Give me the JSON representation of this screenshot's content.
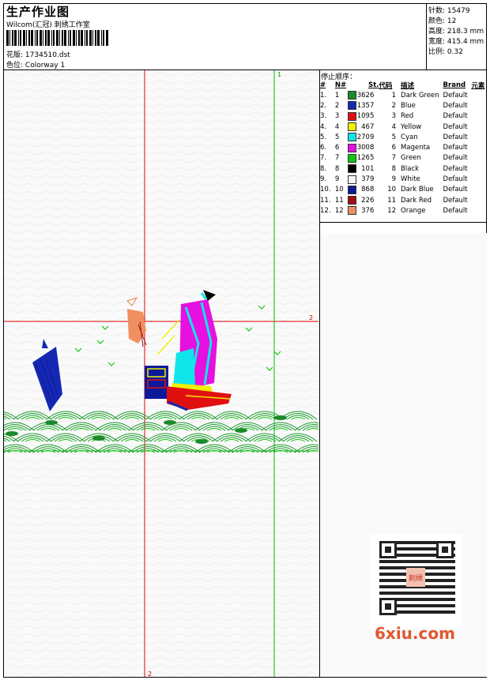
{
  "header": {
    "title": "生产作业图",
    "subtitle": "Wilcom(汇冠) 刺绣工作室",
    "design_label": "花版:",
    "design_value": "1734510.dst",
    "color_label": "色位:",
    "color_value": "Colorway 1"
  },
  "stats": [
    {
      "label": "针数:",
      "value": "15479"
    },
    {
      "label": "颜色:",
      "value": "12"
    },
    {
      "label": "高度:",
      "value": "218.3 mm"
    },
    {
      "label": "宽度:",
      "value": "415.4 mm"
    },
    {
      "label": "比例:",
      "value": "0.32"
    }
  ],
  "legend": {
    "title": "停止顺序：",
    "headers": [
      "#",
      "N#",
      "St.",
      "代码",
      "描述",
      "Brand",
      "元素"
    ],
    "rows": [
      {
        "n": "1.",
        "num": "1",
        "stitches": "3626",
        "code": "1",
        "desc": "Dark Green",
        "brand": "Default",
        "color": "#1a8a2a"
      },
      {
        "n": "2.",
        "num": "2",
        "stitches": "1357",
        "code": "2",
        "desc": "Blue",
        "brand": "Default",
        "color": "#1428b4"
      },
      {
        "n": "3.",
        "num": "3",
        "stitches": "1095",
        "code": "3",
        "desc": "Red",
        "brand": "Default",
        "color": "#e01010"
      },
      {
        "n": "4.",
        "num": "4",
        "stitches": "467",
        "code": "4",
        "desc": "Yellow",
        "brand": "Default",
        "color": "#f0f000"
      },
      {
        "n": "5.",
        "num": "5",
        "stitches": "2709",
        "code": "5",
        "desc": "Cyan",
        "brand": "Default",
        "color": "#10e6ea"
      },
      {
        "n": "6.",
        "num": "6",
        "stitches": "3008",
        "code": "6",
        "desc": "Magenta",
        "brand": "Default",
        "color": "#e610e0"
      },
      {
        "n": "7.",
        "num": "7",
        "stitches": "1265",
        "code": "7",
        "desc": "Green",
        "brand": "Default",
        "color": "#10c810"
      },
      {
        "n": "8.",
        "num": "8",
        "stitches": "101",
        "code": "8",
        "desc": "Black",
        "brand": "Default",
        "color": "#000000"
      },
      {
        "n": "9.",
        "num": "9",
        "stitches": "379",
        "code": "9",
        "desc": "White",
        "brand": "Default",
        "color": "#f4f4f4"
      },
      {
        "n": "10.",
        "num": "10",
        "stitches": "868",
        "code": "10",
        "desc": "Dark Blue",
        "brand": "Default",
        "color": "#0c1a9a"
      },
      {
        "n": "11.",
        "num": "11",
        "stitches": "226",
        "code": "11",
        "desc": "Dark Red",
        "brand": "Default",
        "color": "#a01010"
      },
      {
        "n": "12.",
        "num": "12",
        "stitches": "376",
        "code": "12",
        "desc": "Orange",
        "brand": "Default",
        "color": "#f09060"
      }
    ]
  },
  "canvas": {
    "marker_top": "1",
    "marker_right": "2",
    "marker_bottom": "2",
    "guide_red": "#e00000",
    "guide_green": "#00c000"
  },
  "watermark": {
    "text": "6xiu.com",
    "seal": "刺绣"
  }
}
